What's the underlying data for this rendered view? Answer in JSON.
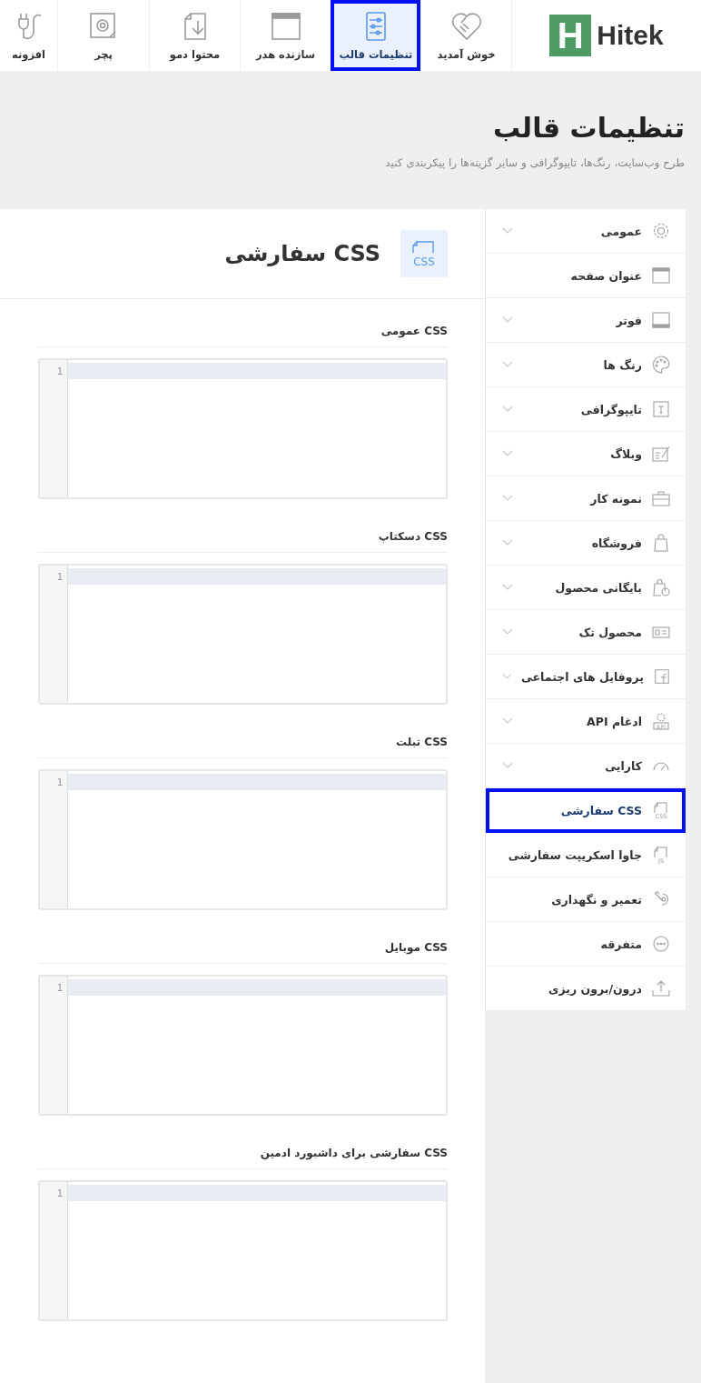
{
  "logo": {
    "mark": "H",
    "text": "Hitek"
  },
  "nav": [
    {
      "label": "خوش آمدید",
      "selected": false
    },
    {
      "label": "تنظیمات قالب",
      "selected": true
    },
    {
      "label": "سازنده هدر",
      "selected": false
    },
    {
      "label": "محتوا دمو",
      "selected": false
    },
    {
      "label": "پچر",
      "selected": false
    },
    {
      "label": "افزونه",
      "selected": false
    }
  ],
  "page": {
    "title": "تنظیمات قالب",
    "subtitle": "طرح وب‌سایت، رنگ‌ها، تایپوگرافی و سایر گزینه‌ها را پیکربندی کنید"
  },
  "sidebar": [
    {
      "label": "عمومی",
      "expandable": true,
      "selected": false
    },
    {
      "label": "عنوان صفحه",
      "expandable": false,
      "selected": false
    },
    {
      "label": "فوتر",
      "expandable": true,
      "selected": false
    },
    {
      "label": "رنگ ها",
      "expandable": true,
      "selected": false
    },
    {
      "label": "تایپوگرافی",
      "expandable": true,
      "selected": false
    },
    {
      "label": "وبلاگ",
      "expandable": true,
      "selected": false
    },
    {
      "label": "نمونه کار",
      "expandable": true,
      "selected": false
    },
    {
      "label": "فروشگاه",
      "expandable": true,
      "selected": false
    },
    {
      "label": "بایگانی محصول",
      "expandable": true,
      "selected": false
    },
    {
      "label": "محصول تک",
      "expandable": true,
      "selected": false
    },
    {
      "label": "پروفایل های اجتماعی",
      "expandable": true,
      "selected": false
    },
    {
      "label": "ادغام API",
      "expandable": true,
      "selected": false,
      "icon_label": "API"
    },
    {
      "label": "کارایی",
      "expandable": true,
      "selected": false
    },
    {
      "label": "CSS سفارشی",
      "expandable": false,
      "selected": true,
      "icon_label": "CSS"
    },
    {
      "label": "جاوا اسکریپت سفارشی",
      "expandable": false,
      "selected": false,
      "icon_label": "JS"
    },
    {
      "label": "تعمیر و نگهداری",
      "expandable": false,
      "selected": false
    },
    {
      "label": "متفرقه",
      "expandable": false,
      "selected": false
    },
    {
      "label": "درون/برون ریزی",
      "expandable": false,
      "selected": false
    }
  ],
  "panel": {
    "title": "CSS سفارشی",
    "icon_label": "CSS",
    "editors": [
      {
        "label": "CSS عمومی",
        "line_number": "1"
      },
      {
        "label": "CSS دسکتاپ",
        "line_number": "1"
      },
      {
        "label": "CSS تبلت",
        "line_number": "1"
      },
      {
        "label": "CSS موبایل",
        "line_number": "1"
      },
      {
        "label": "CSS سفارشی برای داشبورد ادمین",
        "line_number": "1"
      }
    ]
  }
}
